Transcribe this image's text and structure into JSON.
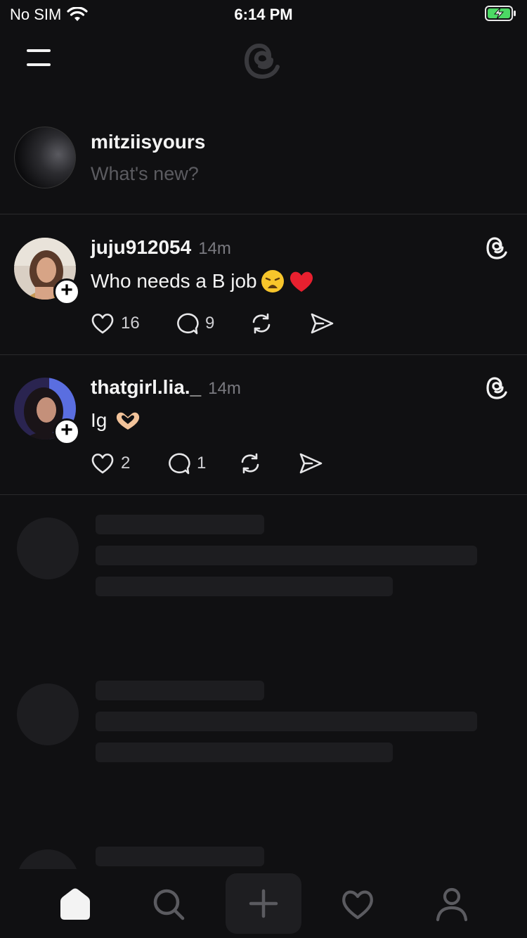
{
  "status_bar": {
    "carrier": "No SIM",
    "time": "6:14 PM"
  },
  "composer": {
    "username": "mitziisyours",
    "placeholder": "What's new?"
  },
  "posts": [
    {
      "username": "juju912054",
      "time_ago": "14m",
      "text": "Who needs a B job",
      "emojis": [
        "weary-face",
        "red-heart"
      ],
      "likes": "16",
      "replies": "9"
    },
    {
      "username": "thatgirl.lia._",
      "time_ago": "14m",
      "text": "Ig",
      "emojis": [
        "heart-hands"
      ],
      "likes": "2",
      "replies": "1"
    }
  ],
  "tabs": [
    "home-icon",
    "search-icon",
    "compose-icon",
    "activity-heart-icon",
    "profile-icon"
  ],
  "colors": {
    "background": "#101012",
    "text": "#f3f3f3",
    "muted": "#7a7a80",
    "skeleton": "#1d1d20",
    "divider": "#2a2a2c"
  }
}
